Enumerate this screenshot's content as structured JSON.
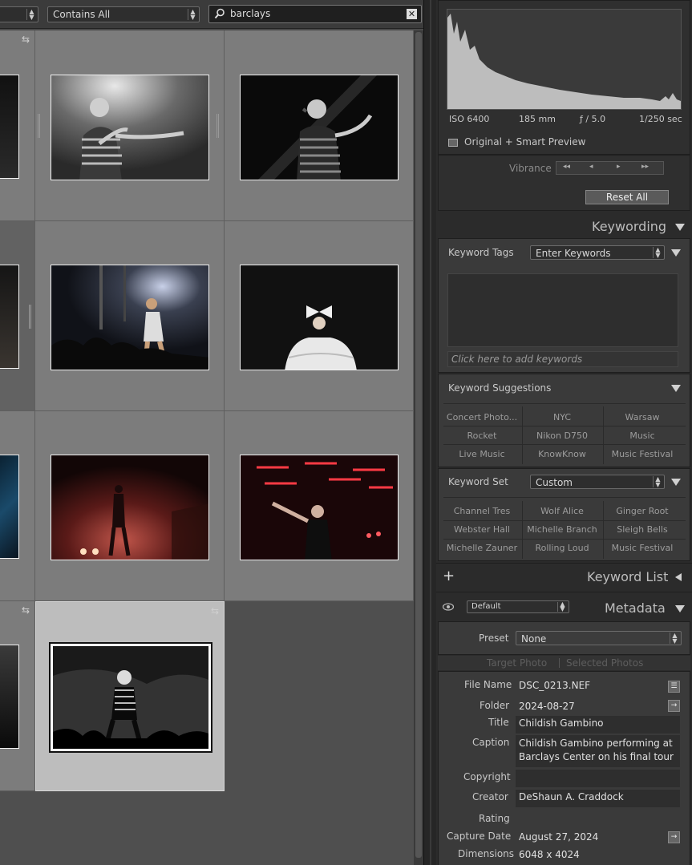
{
  "filter_bar": {
    "first_select": "",
    "match_select": "Contains All",
    "search_value": "barclays"
  },
  "histogram": {
    "iso": "ISO 6400",
    "focal": "185 mm",
    "aperture": "ƒ / 5.0",
    "shutter": "1/250 sec",
    "preview": "Original + Smart Preview"
  },
  "quick_develop": {
    "vibrance_label": "Vibrance",
    "reset_label": "Reset All"
  },
  "keywording": {
    "title": "Keywording",
    "tags_label": "Keyword Tags",
    "tags_select": "Enter Keywords",
    "add_placeholder": "Click here to add keywords",
    "suggestions_label": "Keyword Suggestions",
    "suggestions": [
      "Concert Photo...",
      "NYC",
      "Warsaw",
      "Rocket",
      "Nikon D750",
      "Music",
      "Live Music",
      "KnowKnow",
      "Music Festival"
    ],
    "set_label": "Keyword Set",
    "set_select": "Custom",
    "set_items": [
      "Channel Tres",
      "Wolf Alice",
      "Ginger Root",
      "Webster Hall",
      "Michelle Branch",
      "Sleigh Bells",
      "Michelle Zauner",
      "Rolling Loud",
      "Music Festival"
    ]
  },
  "keyword_list": {
    "title": "Keyword List",
    "plus": "+"
  },
  "metadata": {
    "title": "Metadata",
    "preset_select": "Default",
    "preset_label": "Preset",
    "preset_value": "None",
    "target_photo": "Target Photo",
    "selected_photos": "Selected Photos",
    "file_name_label": "File Name",
    "file_name": "DSC_0213.NEF",
    "folder_label": "Folder",
    "folder": "2024-08-27",
    "title_label": "Title",
    "title_value": "Childish Gambino",
    "caption_label": "Caption",
    "caption_line1": "Childish Gambino performing at",
    "caption_line2": "Barclays Center on his final tour",
    "copyright_label": "Copyright",
    "creator_label": "Creator",
    "creator": "DeShaun A. Craddock",
    "rating_label": "Rating",
    "capture_label": "Capture Date",
    "capture_date": "August 27, 2024",
    "dimensions_label": "Dimensions",
    "dimensions": "6048 x 4024"
  },
  "colors": {
    "panel_bg": "#2b2b2b",
    "section_bg": "#3a3a3a",
    "grid_cell": "#7c7c7c",
    "grid_selected": "#bdbdbd",
    "histogram_fill": "#bdbdbd"
  }
}
